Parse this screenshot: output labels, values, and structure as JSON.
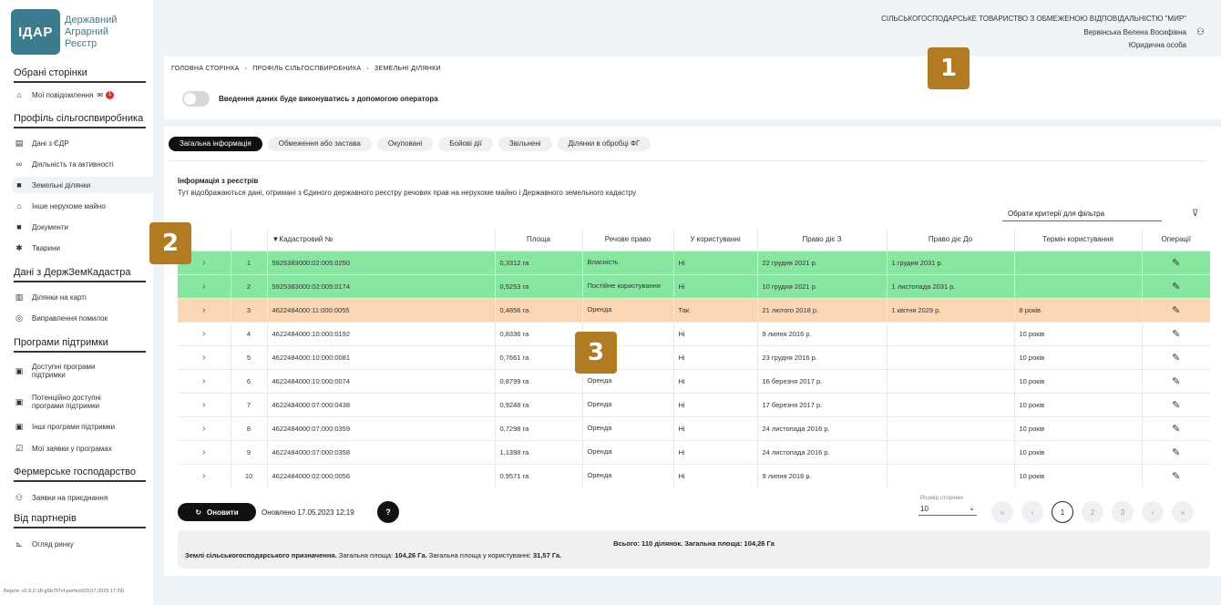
{
  "logo": {
    "abbr": "ІДАР",
    "line1": "Державний",
    "line2": "Аграрний",
    "line3": "Реєстр"
  },
  "sidebar": {
    "sections": [
      "Обрані сторінки",
      "Профіль сільгоспвиробника",
      "Дані з ДержЗемКадастра",
      "Програми підтримки",
      "Фермерське господарство",
      "Від партнерів"
    ],
    "items": [
      {
        "label": "Мої повідомлення",
        "icon": "home-icon",
        "badge": "1"
      },
      {
        "label": "Дані з ЄДР",
        "icon": "register-icon"
      },
      {
        "label": "Діяльність та активності",
        "icon": "binoculars-icon"
      },
      {
        "label": "Земельні ділянки",
        "icon": "land-icon"
      },
      {
        "label": "Інше нерухоме майно",
        "icon": "property-icon"
      },
      {
        "label": "Документи",
        "icon": "folder-icon"
      },
      {
        "label": "Тварини",
        "icon": "animal-icon"
      },
      {
        "label": "Ділянки на карті",
        "icon": "map-icon"
      },
      {
        "label": "Виправлення помилок",
        "icon": "fix-icon"
      },
      {
        "label": "Доступні програми підтримки",
        "icon": "program-icon"
      },
      {
        "label": "Потенційно доступні програми підтримки",
        "icon": "program-icon"
      },
      {
        "label": "Інші програми підтримки",
        "icon": "program-icon"
      },
      {
        "label": "Мої заявки у програмах",
        "icon": "applications-icon"
      },
      {
        "label": "Заявки на приєднання",
        "icon": "join-icon"
      },
      {
        "label": "Огляд ринку",
        "icon": "chart-icon"
      }
    ],
    "version": "Версія: v0.9.2-18-g5b797cf-perfect(03.07.2023 17:29)"
  },
  "header": {
    "org": "СІЛЬСЬКОГОСПОДАРСЬКЕ ТОВАРИСТВО З ОБМЕЖЕНОЮ ВІДПОВІДАЛЬНІСТЮ \"МИР\"",
    "user": "Вервінська Велена Восифівна",
    "role": "Юридична особа"
  },
  "breadcrumb": [
    "ГОЛОВНА СТОРІНКА",
    "ПРОФІЛЬ СІЛЬГОСПВИРОБНИКА",
    "ЗЕМЕЛЬНІ ДІЛЯНКИ"
  ],
  "toggle_label": "Введення даних буде виконуватись з допомогою оператора",
  "tabs": [
    "Загальна інформація",
    "Обмеження або застава",
    "Окуповані",
    "Бойові дії",
    "Звільнені",
    "Ділянки в обробці ФГ"
  ],
  "info": {
    "title": "Інформація з реєстрів",
    "desc": "Тут відображаються дані, отримані з Єдиного державного реєстру речових прав на нерухоме майно і Державного земельного кадастру"
  },
  "filter_placeholder": "Обрати критерії для фільтра",
  "table": {
    "headers": [
      "",
      "",
      "▼Кадастровий №",
      "Площа",
      "Речове право",
      "У користуванні",
      "Право діє З",
      "Право діє До",
      "Термін користування",
      "Операції"
    ],
    "rows": [
      [
        "1",
        "5925383000:02:005:0250",
        "0,3312 га",
        "Власність",
        "Ні",
        "22 грудня 2021 р.",
        "1 грудня 2031 р.",
        ""
      ],
      [
        "2",
        "5925383000:02:005:0174",
        "0,5253 га",
        "Постійне користування",
        "Ні",
        "10 грудня 2021 р.",
        "1 листопада 2031 р.",
        ""
      ],
      [
        "3",
        "4622484000:11:000:0055",
        "0,4856 га",
        "Оренда",
        "Так",
        "21 лютого 2018 р.",
        "1 квітня 2029 р.",
        "8 років"
      ],
      [
        "4",
        "4622484000:10:000:0192",
        "0,8336 га",
        "",
        "Ні",
        "9 липня 2016 р.",
        "",
        "10 років"
      ],
      [
        "5",
        "4622484000:10:000:0081",
        "0,7661 га",
        "",
        "Ні",
        "23 грудня 2016 р.",
        "",
        "10 років"
      ],
      [
        "6",
        "4622484000:10:000:0074",
        "0,8799 га",
        "Оренда",
        "Ні",
        "16 березня 2017 р.",
        "",
        "10 років"
      ],
      [
        "7",
        "4622484000:07:000:0438",
        "0,9248 га",
        "Оренда",
        "Ні",
        "17 березня 2017 р.",
        "",
        "10 років"
      ],
      [
        "8",
        "4622484000:07:000:0359",
        "0,7298 га",
        "Оренда",
        "Ні",
        "24 листопада 2016 р.",
        "",
        "10 років"
      ],
      [
        "9",
        "4622484000:07:000:0358",
        "1,1398 га",
        "Оренда",
        "Ні",
        "24 листопада 2016 р.",
        "",
        "10 років"
      ],
      [
        "10",
        "4622484000:02:000:0056",
        "0,9571 га",
        "Оренда",
        "Ні",
        "9 липня 2016 р.",
        "",
        "10 років"
      ]
    ],
    "row_styles": [
      "green",
      "green",
      "orange",
      "",
      "",
      "",
      "",
      "",
      "",
      ""
    ]
  },
  "markers": [
    "1",
    "2",
    "3"
  ],
  "refresh_label": "Оновити",
  "updated_text": "Оновлено 17.05.2023 12:19",
  "help_label": "?",
  "page_size_label": "Розмір сторінки",
  "page_size": "10",
  "pager": [
    "«",
    "‹",
    "1",
    "2",
    "3",
    "›",
    "»"
  ],
  "summary": {
    "total": "Всього: 110 ділянок. Загальна площа: 104,26 Га",
    "land_label": "Землі сільськогосподарського призначення.",
    "area_label": "Загальна площа:",
    "area_value": "104,26 Га.",
    "used_label": "Загальна площа у користуванні:",
    "used_value": "31,57 Га."
  },
  "colors": {
    "brand": "#3a7b8e",
    "row_green": "#87e6a0",
    "row_orange": "#fbd6b4",
    "marker": "#b27a21"
  }
}
